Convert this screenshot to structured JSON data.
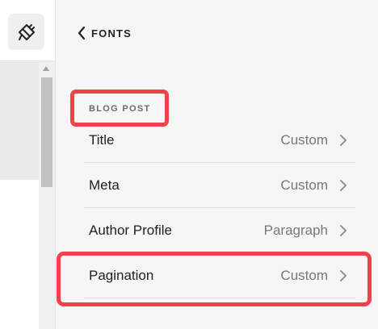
{
  "left": {
    "design_button_icon": "paintbrush-icon"
  },
  "panel": {
    "back": {
      "icon": "chevron-left-icon",
      "label": "FONTS"
    },
    "section_label": "BLOG POST",
    "rows": [
      {
        "label": "Title",
        "value": "Custom"
      },
      {
        "label": "Meta",
        "value": "Custom"
      },
      {
        "label": "Author Profile",
        "value": "Paragraph"
      },
      {
        "label": "Pagination",
        "value": "Custom"
      }
    ]
  },
  "highlights": {
    "color": "#f0424a"
  }
}
